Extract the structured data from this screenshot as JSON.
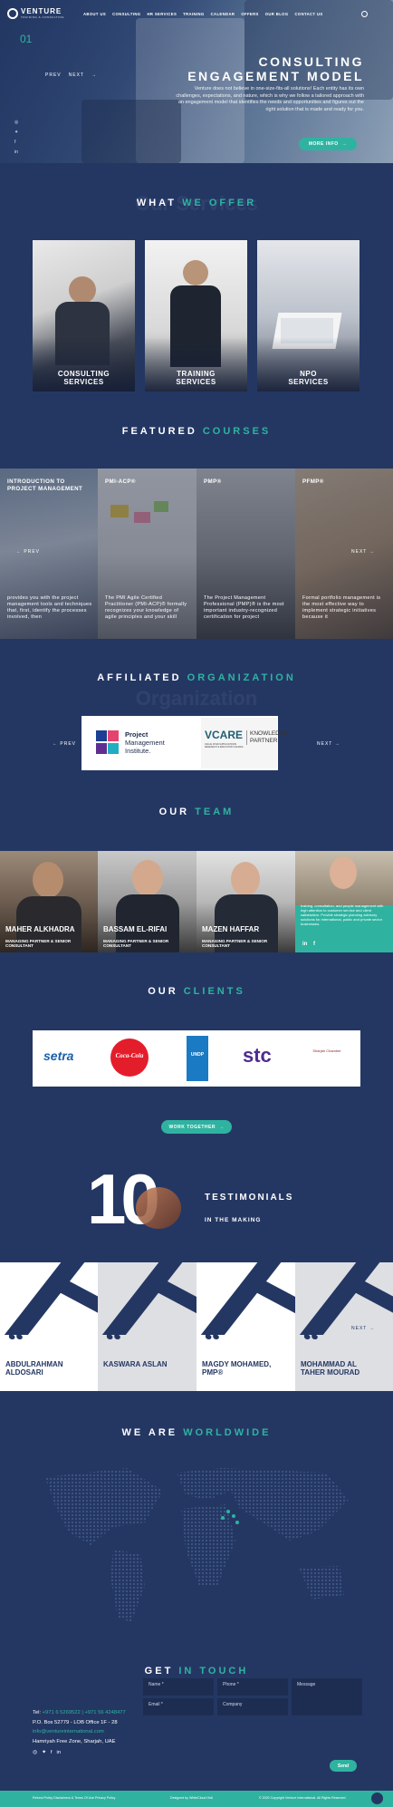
{
  "header": {
    "logo": "VENTURE",
    "logo_sub": "TRAINING & CONSULTING",
    "nav": [
      "ABOUT US",
      "CONSULTING",
      "HR SERVICES",
      "TRAINING",
      "CALENDAR",
      "OFFERS",
      "OUR BLOG",
      "CONTACT US"
    ]
  },
  "hero": {
    "slide_number": "01",
    "prev": "PREV",
    "next": "NEXT",
    "title_line1": "CONSULTING",
    "title_line2": "ENGAGEMENT MODEL",
    "description": "Venture does not believe in one-size-fits-all solutions! Each entity has its own challenges, expectations, and nature, which is why we follow a tailored approach with an engagement model that identifies the needs and opportunities and figures out the right solution that is made and ready for you.",
    "button": "MORE INFO"
  },
  "offer": {
    "title_white": "WHAT",
    "title_teal": "WE OFFER",
    "ghost": "Our Services",
    "cards": [
      {
        "l1": "CONSULTING",
        "l2": "SERVICES"
      },
      {
        "l1": "TRAINING",
        "l2": "SERVICES"
      },
      {
        "l1": "NPO",
        "l2": "SERVICES"
      }
    ]
  },
  "courses": {
    "title_white": "FEATURED",
    "title_teal": "COURSES",
    "prev": "PREV",
    "next": "NEXT",
    "items": [
      {
        "title": "INTRODUCTION TO PROJECT MANAGEMENT",
        "desc": "provides you with the project management tools and techniques that, first, identify the processes involved, then"
      },
      {
        "title": "PMI-ACP®",
        "desc": "The PMI Agile Certified Practitioner (PMI-ACP)® formally recognizes your knowledge of agile principles and your skill"
      },
      {
        "title": "PMP®",
        "desc": "The Project Management Professional (PMP)® is the most important industry-recognized certification for project"
      },
      {
        "title": "PFMP®",
        "desc": "Formal portfolio management is the most effective way to implement strategic initiatives because it"
      }
    ]
  },
  "affiliated": {
    "title_white": "AFFILIATED",
    "title_teal": "ORGANIZATION",
    "ghost": "Organization",
    "prev": "PREV",
    "next": "NEXT",
    "pmi": [
      "Project",
      "Management",
      "Institute."
    ],
    "vcare": "VCARE",
    "vcare_sub": "VALUE CHAIN APPLICATIONS RESEARCH & EDUCATION CANADA",
    "kp": [
      "KNOWLEDGE",
      "PARTNER"
    ]
  },
  "team": {
    "title_white": "OUR",
    "title_teal": "TEAM",
    "members": [
      {
        "name1": "MAHER ALKHADRA",
        "role": "MANAGING PARTNER & SENIOR CONSULTANT"
      },
      {
        "name1": "BASSAM EL-RIFAI",
        "role": "MANAGING PARTNER & SENIOR CONSULTANT"
      },
      {
        "name1": "MAZEN HAFFAR",
        "role": "MANAGING PARTNER & SENIOR CONSULTANT"
      }
    ],
    "featured_text": "training, consultation, and people management with high attention to customer service and client satisfaction. Provide strategic planning advisory solutions for international, public and private sector businesses."
  },
  "clients": {
    "title_white": "OUR",
    "title_teal": "CLIENTS",
    "logos": [
      "setra",
      "Coca-Cola",
      "UNDP",
      "stc",
      "Sharjah Chamber"
    ],
    "button": "WORK TOGETHER"
  },
  "testimonials": {
    "number": "10",
    "label": "TESTIMONIALS",
    "sub": "IN THE MAKING",
    "next": "NEXT",
    "items": [
      {
        "l1": "ABDULRAHMAN",
        "l2": "ALDOSARI"
      },
      {
        "l1": "KASWARA ASLAN",
        "l2": ""
      },
      {
        "l1": "MAGDY MOHAMED,",
        "l2": "PMP®"
      },
      {
        "l1": "MOHAMMAD AL",
        "l2": "TAHER MOURAD"
      }
    ]
  },
  "worldwide": {
    "title_white": "WE ARE",
    "title_teal": "WORLDWIDE"
  },
  "contact": {
    "title_white": "GET",
    "title_teal": "IN TOUCH",
    "phone_label": "Tel:",
    "phone": "+971 6 5269522 | +971 56 4248477",
    "po": "P.O. Box 52779 - LOB Office 1F - 28",
    "email": "info@ventureinternational.com",
    "address": "Hamriyah Free Zone, Sharjah, UAE",
    "fields": {
      "name": "Name *",
      "phone": "Phone *",
      "email": "Email *",
      "company": "Company",
      "message": "Message"
    },
    "send": "Send"
  },
  "footer": {
    "left": "Refund Policy   Disclaimers & Terms Of Use   Privacy Policy",
    "mid": "Designed by WhiteCloud Hub",
    "right": "© 2020 Copyright Venture International. All Rights Reserved"
  },
  "colors": {
    "bg": "#243763",
    "accent": "#2fb3a0"
  }
}
